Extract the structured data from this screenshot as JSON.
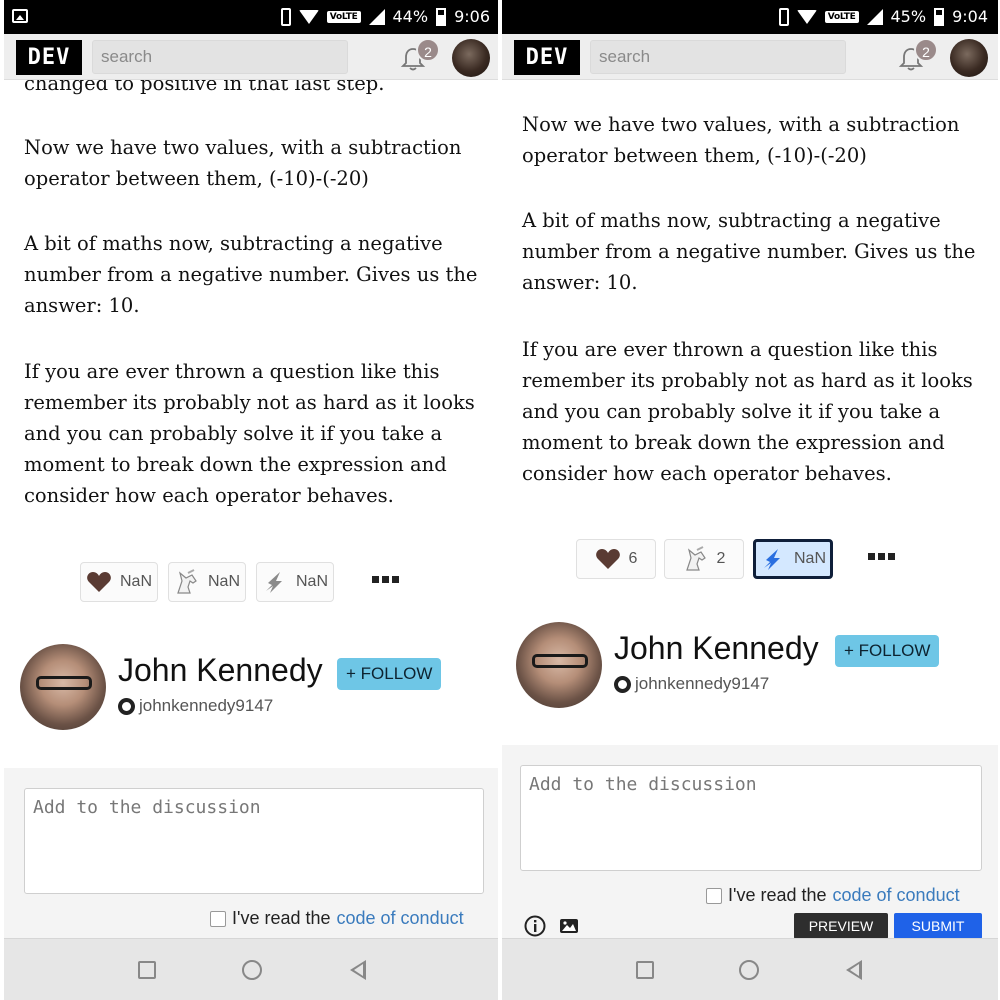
{
  "left": {
    "status": {
      "battery": "44%",
      "time": "9:06",
      "network": "VoLTE"
    },
    "header": {
      "logo": "DEV",
      "search_placeholder": "search",
      "notifications": "2"
    },
    "article": {
      "partial_line": "changed to positive in that last step.",
      "paragraphs": [
        "Now we have two values, with a subtraction operator between them, (-10)-(-20)",
        "A bit of maths now, subtracting a negative number from a negative number. Gives us the answer: 10.",
        "If you are ever thrown a question like this remember its probably not as hard as it looks and you can probably solve it if you take a moment to break down the expression and consider how each operator behaves."
      ]
    },
    "reactions": {
      "heart": "NaN",
      "unicorn": "NaN",
      "bookmark": "NaN"
    },
    "author": {
      "name": "John Kennedy",
      "follow": "+ FOLLOW",
      "github": "johnkennedy9147"
    },
    "discussion": {
      "placeholder": "Add to the discussion",
      "coc_prefix": "I've read the",
      "coc_link": "code of conduct"
    }
  },
  "right": {
    "status": {
      "battery": "45%",
      "time": "9:04",
      "network": "VoLTE"
    },
    "header": {
      "logo": "DEV",
      "search_placeholder": "search",
      "notifications": "2"
    },
    "article": {
      "paragraphs": [
        "Now we have two values, with a subtraction operator between them, (-10)-(-20)",
        "A bit of maths now, subtracting a negative number from a negative number. Gives us the answer: 10.",
        "If you are ever thrown a question like this remember its probably not as hard as it looks and you can probably solve it if you take a moment to break down the expression and consider how each operator behaves."
      ]
    },
    "reactions": {
      "heart": "6",
      "unicorn": "2",
      "bookmark": "NaN"
    },
    "author": {
      "name": "John Kennedy",
      "follow": "+ FOLLOW",
      "github": "johnkennedy9147"
    },
    "discussion": {
      "placeholder": "Add to the discussion",
      "coc_prefix": "I've read the",
      "coc_link": "code of conduct",
      "preview": "PREVIEW",
      "submit": "SUBMIT"
    }
  },
  "colors": {
    "follow": "#6ec6e6",
    "submit": "#1f62e8",
    "link": "#3a7bbd",
    "bookmark_active_bg": "#d4e8ff"
  }
}
